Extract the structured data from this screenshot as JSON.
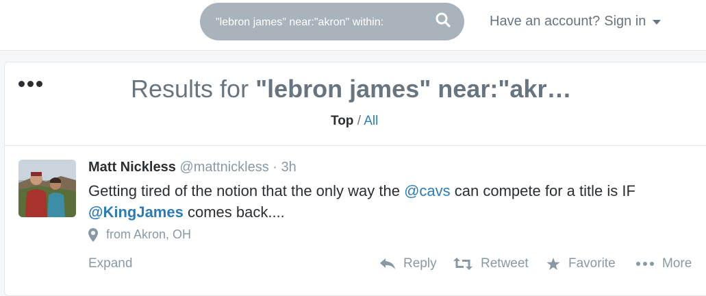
{
  "search": {
    "value": "\"lebron james\" near:\"akron\" within:",
    "icon": "search-icon"
  },
  "account": {
    "prefix": "Have an account?",
    "signin": "Sign in"
  },
  "results": {
    "prefix": "Results for",
    "query": "\"lebron james\" near:\"akr…"
  },
  "filter": {
    "top": "Top",
    "separator": " / ",
    "all": "All"
  },
  "tweet": {
    "name": "Matt Nickless",
    "handle": "@mattnickless",
    "separator": " · ",
    "time": "3h",
    "text": {
      "part1": "Getting tired of the notion that the only way the ",
      "mention1": "@cavs",
      "part2": " can compete for a title is IF ",
      "mention2": "@KingJames",
      "part3": " comes back...."
    },
    "location": "from Akron, OH"
  },
  "actions": {
    "expand": "Expand",
    "reply": "Reply",
    "retweet": "Retweet",
    "favorite": "Favorite",
    "more": "More"
  },
  "colors": {
    "link": "#2b7bb9",
    "muted": "#8899a6",
    "text": "#292f33",
    "search_bg": "#a8b3bb"
  }
}
